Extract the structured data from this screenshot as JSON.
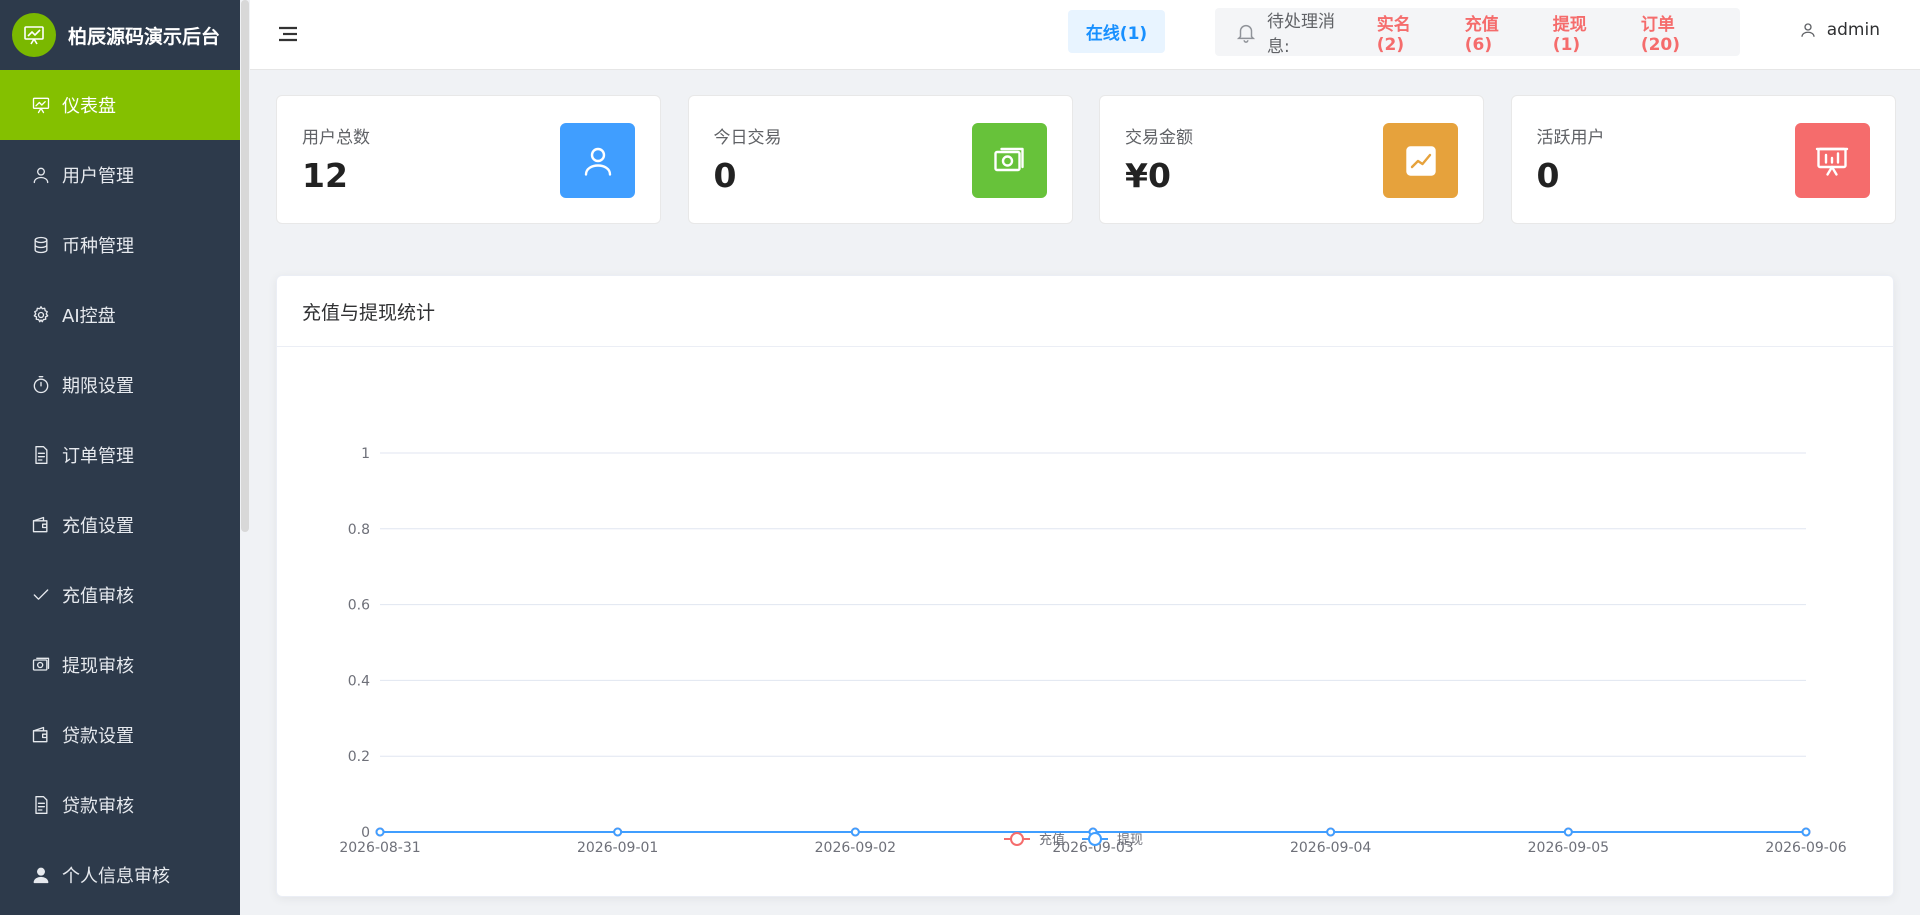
{
  "app": {
    "title": "柏辰源码演示后台"
  },
  "sidebar": {
    "items": [
      {
        "label": "仪表盘",
        "icon": "dashboard-icon",
        "active": true
      },
      {
        "label": "用户管理",
        "icon": "user-icon",
        "active": false
      },
      {
        "label": "币种管理",
        "icon": "coins-icon",
        "active": false
      },
      {
        "label": "AI控盘",
        "icon": "gear-icon",
        "active": false
      },
      {
        "label": "期限设置",
        "icon": "timer-icon",
        "active": false
      },
      {
        "label": "订单管理",
        "icon": "document-icon",
        "active": false
      },
      {
        "label": "充值设置",
        "icon": "wallet-icon",
        "active": false
      },
      {
        "label": "充值审核",
        "icon": "check-icon",
        "active": false
      },
      {
        "label": "提现审核",
        "icon": "money-icon",
        "active": false
      },
      {
        "label": "贷款设置",
        "icon": "wallet-icon",
        "active": false
      },
      {
        "label": "贷款审核",
        "icon": "document-icon",
        "active": false
      },
      {
        "label": "个人信息审核",
        "icon": "person-filled-icon",
        "active": false
      }
    ]
  },
  "header": {
    "online": "在线(1)",
    "pending_label": "待处理消息:",
    "pending": [
      {
        "label": "实名(2)"
      },
      {
        "label": "充值(6)"
      },
      {
        "label": "提现(1)"
      },
      {
        "label": "订单(20)"
      }
    ],
    "user": "admin"
  },
  "stats": [
    {
      "label": "用户总数",
      "value": "12",
      "color": "#409eff",
      "icon": "user-icon"
    },
    {
      "label": "今日交易",
      "value": "0",
      "color": "#67c23a",
      "icon": "money-icon"
    },
    {
      "label": "交易金额",
      "value": "¥0",
      "color": "#e6a23c",
      "icon": "trend-chart-icon"
    },
    {
      "label": "活跃用户",
      "value": "0",
      "color": "#f56c6c",
      "icon": "presentation-icon"
    }
  ],
  "panel": {
    "title": "充值与提现统计"
  },
  "chart_data": {
    "type": "line",
    "categories": [
      "2026-08-31",
      "2026-09-01",
      "2026-09-02",
      "2026-09-03",
      "2026-09-04",
      "2026-09-05",
      "2026-09-06"
    ],
    "series": [
      {
        "name": "充值",
        "color": "#f56c6c",
        "values": [
          0,
          0,
          0,
          0,
          0,
          0,
          0
        ]
      },
      {
        "name": "提现",
        "color": "#409eff",
        "values": [
          0,
          0,
          0,
          0,
          0,
          0,
          0
        ]
      }
    ],
    "yticks": [
      "0",
      "0.2",
      "0.4",
      "0.6",
      "0.8",
      "1"
    ],
    "ylim": [
      0,
      1
    ],
    "grid": true,
    "legend": "bottom-center"
  }
}
